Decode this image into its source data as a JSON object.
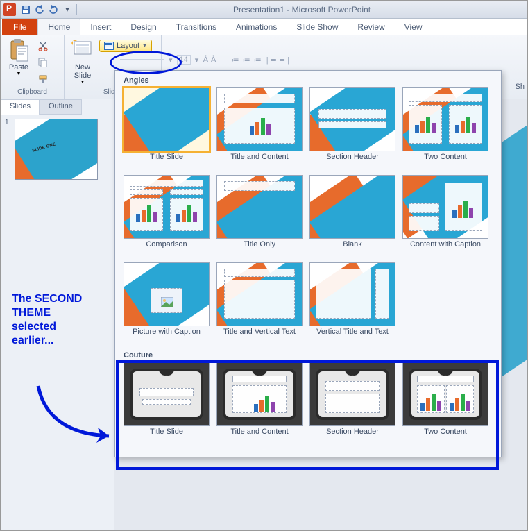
{
  "app": {
    "title": "Presentation1 - Microsoft PowerPoint"
  },
  "qat": {
    "save": "save-icon",
    "undo": "undo-icon",
    "redo": "redo-icon",
    "custom": "dropdown-icon"
  },
  "tabs": {
    "file": "File",
    "items": [
      "Home",
      "Insert",
      "Design",
      "Transitions",
      "Animations",
      "Slide Show",
      "Review",
      "View"
    ],
    "active": "Home"
  },
  "ribbon": {
    "clipboard": {
      "paste": "Paste",
      "label": "Clipboard"
    },
    "slides": {
      "newSlide": "New\nSlide",
      "layout": "Layout",
      "label": "Slides"
    },
    "font_hint": "14",
    "shapes_hint": "Sh"
  },
  "leftPane": {
    "tabs": [
      "Slides",
      "Outline"
    ],
    "active": "Slides",
    "slideNumber": "1",
    "slideLabel": "SLIDE ONE"
  },
  "gallery": {
    "sections": [
      {
        "title": "Angles",
        "items": [
          {
            "label": "Title Slide",
            "selected": true,
            "kind": "ang"
          },
          {
            "label": "Title and Content",
            "kind": "ang-content"
          },
          {
            "label": "Section Header",
            "kind": "ang-section"
          },
          {
            "label": "Two Content",
            "kind": "ang-two"
          },
          {
            "label": "Comparison",
            "kind": "ang-compare"
          },
          {
            "label": "Title Only",
            "kind": "ang-titleonly"
          },
          {
            "label": "Blank",
            "kind": "ang-blank"
          },
          {
            "label": "Content with Caption",
            "kind": "ang-capcontent"
          },
          {
            "label": "Picture with Caption",
            "kind": "ang-piccap"
          },
          {
            "label": "Title and Vertical Text",
            "kind": "ang-tvtext"
          },
          {
            "label": "Vertical Title and Text",
            "kind": "ang-vttext"
          }
        ]
      },
      {
        "title": "Couture",
        "items": [
          {
            "label": "Title Slide",
            "kind": "cou-title"
          },
          {
            "label": "Title and Content",
            "kind": "cou-content"
          },
          {
            "label": "Section Header",
            "kind": "cou-section"
          },
          {
            "label": "Two Content",
            "kind": "cou-two"
          }
        ]
      }
    ]
  },
  "annotations": {
    "text": "The SECOND THEME selected earlier..."
  }
}
